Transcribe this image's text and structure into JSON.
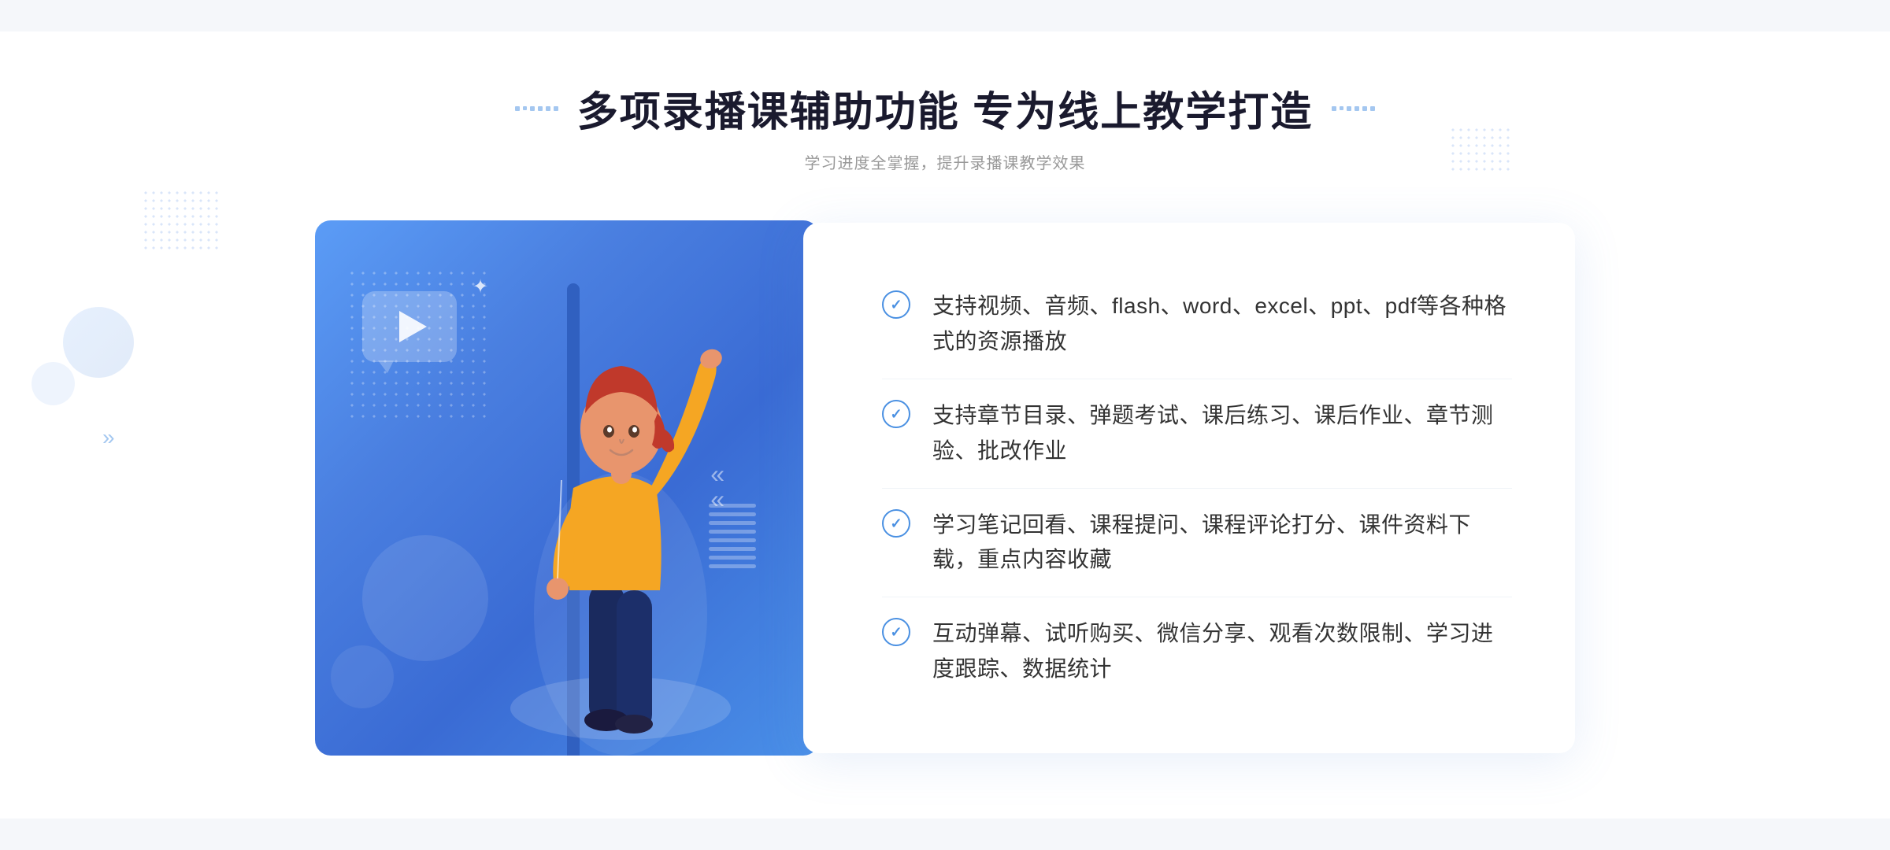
{
  "header": {
    "title": "多项录播课辅助功能 专为线上教学打造",
    "subtitle": "学习进度全掌握，提升录播课教学效果",
    "deco_left": "❮❮",
    "deco_right": "❯❯"
  },
  "features": [
    {
      "id": 1,
      "text": "支持视频、音频、flash、word、excel、ppt、pdf等各种格式的资源播放"
    },
    {
      "id": 2,
      "text": "支持章节目录、弹题考试、课后练习、课后作业、章节测验、批改作业"
    },
    {
      "id": 3,
      "text": "学习笔记回看、课程提问、课程评论打分、课件资料下载，重点内容收藏"
    },
    {
      "id": 4,
      "text": "互动弹幕、试听购买、微信分享、观看次数限制、学习进度跟踪、数据统计"
    }
  ],
  "illustration": {
    "play_button": "▶",
    "sparkle": "✦",
    "arrows": "«"
  },
  "colors": {
    "primary": "#4a90e2",
    "title": "#1a1a2e",
    "text": "#333333",
    "subtitle": "#999999",
    "gradient_start": "#5b9cf6",
    "gradient_end": "#3a6bd4"
  }
}
